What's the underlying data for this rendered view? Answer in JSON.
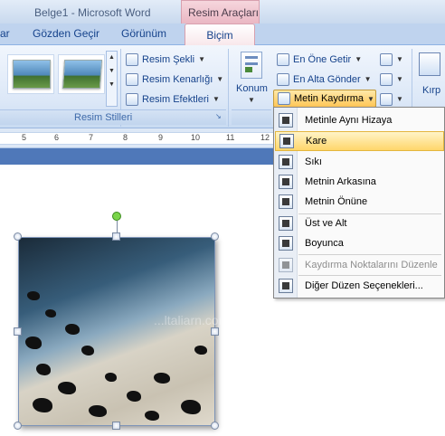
{
  "window": {
    "title": "Belge1 - Microsoft Word",
    "context_tab_title": "Resim Araçları"
  },
  "tabs": {
    "t1": "ar",
    "t2": "Gözden Geçir",
    "t3": "Görünüm",
    "active": "Biçim"
  },
  "ribbon": {
    "resim_sekli": "Resim Şekli",
    "resim_kenarligi": "Resim Kenarlığı",
    "resim_efektleri": "Resim Efektleri",
    "group_resim_stilleri": "Resim Stilleri",
    "konum": "Konum",
    "en_one_getir": "En Öne Getir",
    "en_alta_gonder": "En Alta Gönder",
    "metin_kaydirma": "Metin Kaydırma",
    "kirp": "Kırp"
  },
  "ruler": {
    "marks": [
      "5",
      "6",
      "7",
      "8",
      "9",
      "10",
      "11",
      "12"
    ]
  },
  "menu": {
    "items": [
      "Metinle Aynı Hizaya",
      "Kare",
      "Sıkı",
      "Metnin Arkasına",
      "Metnin Önüne",
      "Üst ve Alt",
      "Boyunca",
      "Kaydırma Noktalarını Düzenle",
      "Diğer Düzen Seçenekleri..."
    ]
  },
  "image": {
    "watermark": "...ltaliarn.com"
  },
  "colors": {
    "accent": "#15428b",
    "highlight": "#ffd66b",
    "context_tab": "#eab7c3",
    "rotation_handle": "#7ad54a"
  }
}
